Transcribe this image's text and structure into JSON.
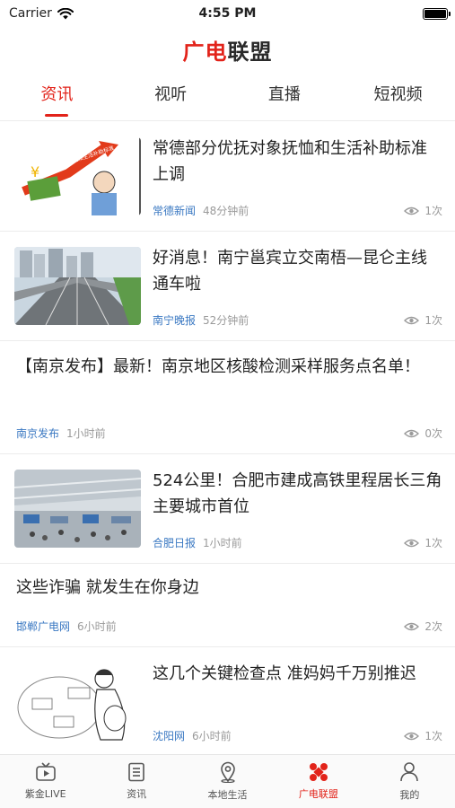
{
  "status": {
    "carrier": "Carrier",
    "time": "4:55 PM"
  },
  "header": {
    "logo_red": "广电",
    "logo_dark": "联盟"
  },
  "tabs": [
    {
      "label": "资讯",
      "active": true
    },
    {
      "label": "视听",
      "active": false
    },
    {
      "label": "直播",
      "active": false
    },
    {
      "label": "短视频",
      "active": false
    }
  ],
  "feed": [
    {
      "title": "常德部分优抚对象抚恤和生活补助标准上调",
      "source": "常德新闻",
      "ago": "48分钟前",
      "views": "1次",
      "thumb_text": "抚恤和生活补助标准"
    },
    {
      "title": "好消息！南宁邕宾立交南梧—昆仑主线通车啦",
      "source": "南宁晚报",
      "ago": "52分钟前",
      "views": "1次"
    },
    {
      "title": "【南京发布】最新！南京地区核酸检测采样服务点名单！",
      "source": "南京发布",
      "ago": "1小时前",
      "views": "0次"
    },
    {
      "title": "524公里！合肥市建成高铁里程居长三角主要城市首位",
      "source": "合肥日报",
      "ago": "1小时前",
      "views": "1次"
    },
    {
      "title": "这些诈骗 就发生在你身边",
      "source": "邯郸广电网",
      "ago": "6小时前",
      "views": "2次"
    },
    {
      "title": "这几个关键检查点 准妈妈千万别推迟",
      "source": "沈阳网",
      "ago": "6小时前",
      "views": "1次"
    }
  ],
  "bottom_nav": [
    {
      "label": "紫金LIVE",
      "icon": "tv-icon",
      "active": false
    },
    {
      "label": "资讯",
      "icon": "news-list-icon",
      "active": false
    },
    {
      "label": "本地生活",
      "icon": "location-pin-icon",
      "active": false
    },
    {
      "label": "广电联盟",
      "icon": "alliance-icon",
      "active": true
    },
    {
      "label": "我的",
      "icon": "user-icon",
      "active": false
    }
  ],
  "colors": {
    "accent": "#e2231a",
    "source_blue": "#3a78c2",
    "muted": "#9a9a9a"
  }
}
